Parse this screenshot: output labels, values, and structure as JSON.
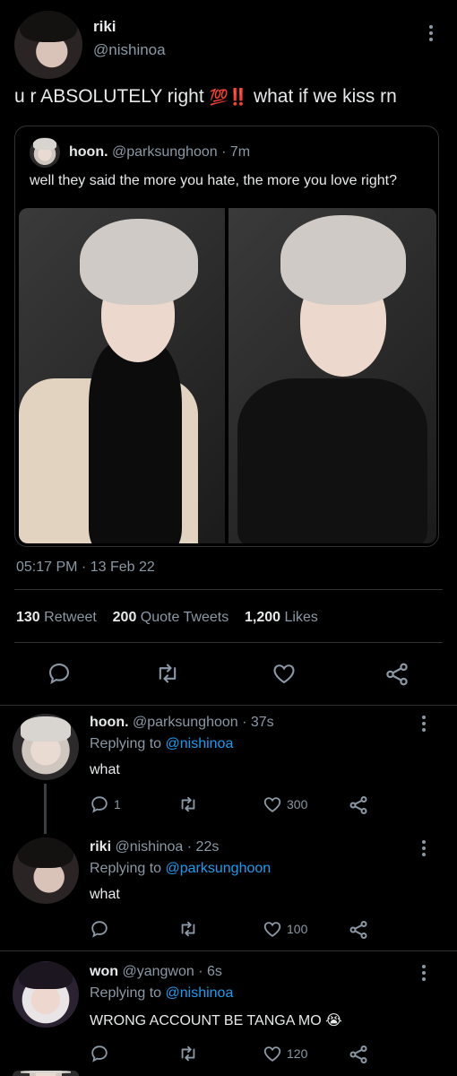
{
  "main_tweet": {
    "name": "riki",
    "handle": "@nishinoa",
    "text_before": "u r ABSOLUTELY right",
    "emoji_100": "💯",
    "emoji_exclaim": "‼️",
    "text_after": "what if we kiss rn",
    "quoted": {
      "name": "hoon.",
      "handle": "@parksunghoon",
      "time": "· 7m",
      "text": "well they said the more you hate, the more you love right?"
    },
    "timestamp": "05:17 PM · 13 Feb 22",
    "stats": {
      "retweets": "130",
      "retweet_label": "Retweet",
      "quotes": "200",
      "quote_label": "Quote Tweets",
      "likes": "1,200",
      "like_label": "Likes"
    }
  },
  "replies": [
    {
      "name": "hoon.",
      "handle": "@parksunghoon",
      "time": "· 37s",
      "replying_prefix": "Replying to",
      "replying_to": "@nishinoa",
      "text": "what",
      "reply_count": "1",
      "retweet_count": "",
      "like_count": "300"
    },
    {
      "name": "riki",
      "handle": "@nishinoa",
      "time": "· 22s",
      "replying_prefix": "Replying to",
      "replying_to": "@parksunghoon",
      "text": "what",
      "reply_count": "",
      "retweet_count": "",
      "like_count": "100"
    },
    {
      "name": "won",
      "handle": "@yangwon",
      "time": "· 6s",
      "replying_prefix": "Replying to",
      "replying_to": "@nishinoa",
      "text": "WRONG ACCOUNT BE TANGA MO",
      "emoji": "😭",
      "reply_count": "",
      "retweet_count": "",
      "like_count": "120"
    }
  ],
  "icons": [
    "more-icon",
    "reply-icon",
    "retweet-icon",
    "like-icon",
    "share-icon"
  ],
  "colors": {
    "background": "#000000",
    "text": "#e7e9ea",
    "muted": "#8b98a5",
    "link": "#1d9bf0",
    "divider": "#2f3336",
    "emoji_red": "#e0245e"
  }
}
